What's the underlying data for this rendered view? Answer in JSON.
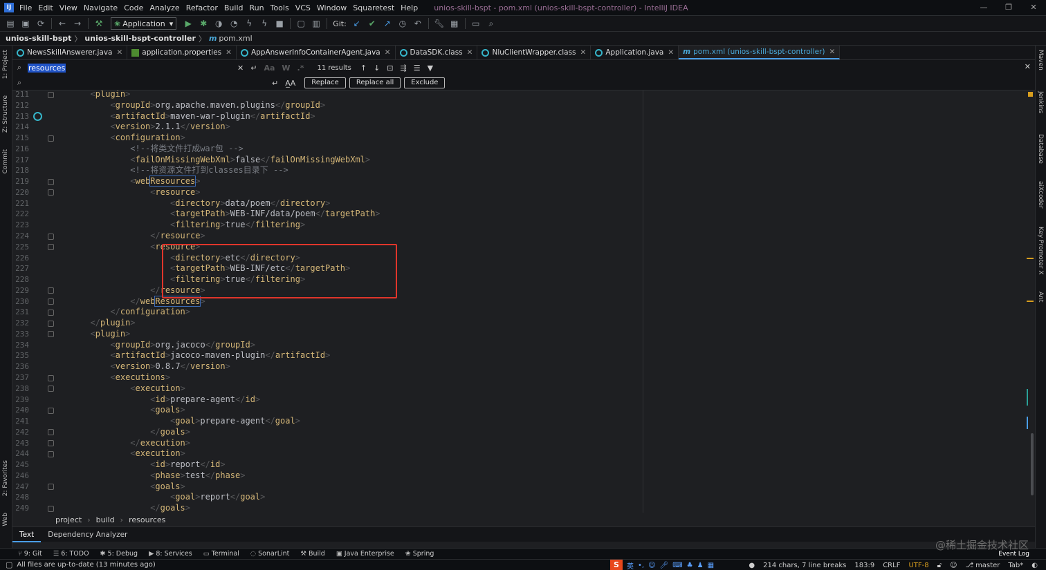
{
  "window": {
    "title": "unios-skill-bspt - pom.xml (unios-skill-bspt-controller) - IntelliJ IDEA",
    "menu": [
      "File",
      "Edit",
      "View",
      "Navigate",
      "Code",
      "Analyze",
      "Refactor",
      "Build",
      "Run",
      "Tools",
      "VCS",
      "Window",
      "Squaretest",
      "Help"
    ]
  },
  "toolbar": {
    "run_config": "Application",
    "git_label": "Git:"
  },
  "breadcrumb": {
    "project": "unios-skill-bspt",
    "module": "unios-skill-bspt-controller",
    "file_prefix": "m",
    "file": "pom.xml"
  },
  "tabs": [
    {
      "label": "NewsSkillAnswerer.java",
      "icon": "java-class-icon"
    },
    {
      "label": "application.properties",
      "icon": "properties-file-icon"
    },
    {
      "label": "AppAnswerInfoContainerAgent.java",
      "icon": "java-class-icon"
    },
    {
      "label": "DataSDK.class",
      "icon": "class-file-icon"
    },
    {
      "label": "NluClientWrapper.class",
      "icon": "class-file-icon"
    },
    {
      "label": "Application.java",
      "icon": "java-class-icon"
    },
    {
      "label": "pom.xml (unios-skill-bspt-controller)",
      "icon": "maven-icon",
      "prefix": "m"
    }
  ],
  "find": {
    "query": "resources",
    "case_btn": "Aa",
    "words_btn": "W",
    "regex_btn": ".*",
    "results": "11 results",
    "replace_label": "Replace",
    "replace_all_label": "Replace all",
    "exclude_label": "Exclude",
    "replace_aa": "A̲A"
  },
  "code": {
    "lines": [
      {
        "n": "211",
        "i": 2,
        "p": [
          [
            "b",
            "<"
          ],
          [
            "t",
            "plugin"
          ],
          [
            "b",
            ">"
          ]
        ]
      },
      {
        "n": "212",
        "i": 3,
        "p": [
          [
            "b",
            "<"
          ],
          [
            "t",
            "groupId"
          ],
          [
            "b",
            ">"
          ],
          [
            "tx",
            "org.apache.maven.plugins"
          ],
          [
            "b",
            "</"
          ],
          [
            "t",
            "groupId"
          ],
          [
            "b",
            ">"
          ]
        ]
      },
      {
        "n": "213",
        "i": 3,
        "p": [
          [
            "b",
            "<"
          ],
          [
            "t",
            "artifactId"
          ],
          [
            "b",
            ">"
          ],
          [
            "tx",
            "maven-war-plugin"
          ],
          [
            "b",
            "</"
          ],
          [
            "t",
            "artifactId"
          ],
          [
            "b",
            ">"
          ]
        ]
      },
      {
        "n": "214",
        "i": 3,
        "p": [
          [
            "b",
            "<"
          ],
          [
            "t",
            "version"
          ],
          [
            "b",
            ">"
          ],
          [
            "tx",
            "2.1.1"
          ],
          [
            "b",
            "</"
          ],
          [
            "t",
            "version"
          ],
          [
            "b",
            ">"
          ]
        ]
      },
      {
        "n": "215",
        "i": 3,
        "p": [
          [
            "b",
            "<"
          ],
          [
            "t",
            "configuration"
          ],
          [
            "b",
            ">"
          ]
        ]
      },
      {
        "n": "216",
        "i": 4,
        "p": [
          [
            "c",
            "<!--将类文件打成war包 -->"
          ]
        ]
      },
      {
        "n": "217",
        "i": 4,
        "p": [
          [
            "b",
            "<"
          ],
          [
            "t",
            "failOnMissingWebXml"
          ],
          [
            "b",
            ">"
          ],
          [
            "tx",
            "false"
          ],
          [
            "b",
            "</"
          ],
          [
            "t",
            "failOnMissingWebXml"
          ],
          [
            "b",
            ">"
          ]
        ]
      },
      {
        "n": "218",
        "i": 4,
        "p": [
          [
            "c",
            "<!--将资源文件打到classes目录下 -->"
          ]
        ]
      },
      {
        "n": "219",
        "i": 4,
        "p": [
          [
            "b",
            "<"
          ],
          [
            "t",
            "web"
          ],
          [
            "hl",
            "Resources"
          ],
          [
            "b",
            ">"
          ]
        ]
      },
      {
        "n": "220",
        "i": 5,
        "p": [
          [
            "b",
            "<"
          ],
          [
            "t",
            "resource"
          ],
          [
            "b",
            ">"
          ]
        ]
      },
      {
        "n": "221",
        "i": 6,
        "p": [
          [
            "b",
            "<"
          ],
          [
            "t",
            "directory"
          ],
          [
            "b",
            ">"
          ],
          [
            "tx",
            "data/poem"
          ],
          [
            "b",
            "</"
          ],
          [
            "t",
            "directory"
          ],
          [
            "b",
            ">"
          ]
        ]
      },
      {
        "n": "222",
        "i": 6,
        "p": [
          [
            "b",
            "<"
          ],
          [
            "t",
            "targetPath"
          ],
          [
            "b",
            ">"
          ],
          [
            "tx",
            "WEB-INF/data/poem"
          ],
          [
            "b",
            "</"
          ],
          [
            "t",
            "targetPath"
          ],
          [
            "b",
            ">"
          ]
        ]
      },
      {
        "n": "223",
        "i": 6,
        "p": [
          [
            "b",
            "<"
          ],
          [
            "t",
            "filtering"
          ],
          [
            "b",
            ">"
          ],
          [
            "tx",
            "true"
          ],
          [
            "b",
            "</"
          ],
          [
            "t",
            "filtering"
          ],
          [
            "b",
            ">"
          ]
        ]
      },
      {
        "n": "224",
        "i": 5,
        "p": [
          [
            "b",
            "</"
          ],
          [
            "t",
            "resource"
          ],
          [
            "b",
            ">"
          ]
        ]
      },
      {
        "n": "225",
        "i": 5,
        "p": [
          [
            "b",
            "<"
          ],
          [
            "t",
            "resource"
          ],
          [
            "b",
            ">"
          ]
        ]
      },
      {
        "n": "226",
        "i": 6,
        "p": [
          [
            "b",
            "<"
          ],
          [
            "t",
            "directory"
          ],
          [
            "b",
            ">"
          ],
          [
            "tx",
            "etc"
          ],
          [
            "b",
            "</"
          ],
          [
            "t",
            "directory"
          ],
          [
            "b",
            ">"
          ]
        ]
      },
      {
        "n": "227",
        "i": 6,
        "p": [
          [
            "b",
            "<"
          ],
          [
            "t",
            "targetPath"
          ],
          [
            "b",
            ">"
          ],
          [
            "tx",
            "WEB-INF/etc"
          ],
          [
            "b",
            "</"
          ],
          [
            "t",
            "targetPath"
          ],
          [
            "b",
            ">"
          ]
        ]
      },
      {
        "n": "228",
        "i": 6,
        "p": [
          [
            "b",
            "<"
          ],
          [
            "t",
            "filtering"
          ],
          [
            "b",
            ">"
          ],
          [
            "tx",
            "true"
          ],
          [
            "b",
            "</"
          ],
          [
            "t",
            "filtering"
          ],
          [
            "b",
            ">"
          ]
        ]
      },
      {
        "n": "229",
        "i": 5,
        "p": [
          [
            "b",
            "</"
          ],
          [
            "t",
            "resource"
          ],
          [
            "b",
            ">"
          ]
        ]
      },
      {
        "n": "230",
        "i": 4,
        "p": [
          [
            "b",
            "</"
          ],
          [
            "t",
            "web"
          ],
          [
            "hl",
            "Resources"
          ],
          [
            "b",
            ">"
          ]
        ]
      },
      {
        "n": "231",
        "i": 3,
        "p": [
          [
            "b",
            "</"
          ],
          [
            "t",
            "configuration"
          ],
          [
            "b",
            ">"
          ]
        ]
      },
      {
        "n": "232",
        "i": 2,
        "p": [
          [
            "b",
            "</"
          ],
          [
            "t",
            "plugin"
          ],
          [
            "b",
            ">"
          ]
        ]
      },
      {
        "n": "233",
        "i": 2,
        "p": [
          [
            "b",
            "<"
          ],
          [
            "t",
            "plugin"
          ],
          [
            "b",
            ">"
          ]
        ]
      },
      {
        "n": "234",
        "i": 3,
        "p": [
          [
            "b",
            "<"
          ],
          [
            "t",
            "groupId"
          ],
          [
            "b",
            ">"
          ],
          [
            "tx",
            "org.jacoco"
          ],
          [
            "b",
            "</"
          ],
          [
            "t",
            "groupId"
          ],
          [
            "b",
            ">"
          ]
        ]
      },
      {
        "n": "235",
        "i": 3,
        "p": [
          [
            "b",
            "<"
          ],
          [
            "t",
            "artifactId"
          ],
          [
            "b",
            ">"
          ],
          [
            "tx",
            "jacoco-maven-plugin"
          ],
          [
            "b",
            "</"
          ],
          [
            "t",
            "artifactId"
          ],
          [
            "b",
            ">"
          ]
        ]
      },
      {
        "n": "236",
        "i": 3,
        "p": [
          [
            "b",
            "<"
          ],
          [
            "t",
            "version"
          ],
          [
            "b",
            ">"
          ],
          [
            "tx",
            "0.8.7"
          ],
          [
            "b",
            "</"
          ],
          [
            "t",
            "version"
          ],
          [
            "b",
            ">"
          ]
        ]
      },
      {
        "n": "237",
        "i": 3,
        "p": [
          [
            "b",
            "<"
          ],
          [
            "t",
            "executions"
          ],
          [
            "b",
            ">"
          ]
        ]
      },
      {
        "n": "238",
        "i": 4,
        "p": [
          [
            "b",
            "<"
          ],
          [
            "t",
            "execution"
          ],
          [
            "b",
            ">"
          ]
        ]
      },
      {
        "n": "239",
        "i": 5,
        "p": [
          [
            "b",
            "<"
          ],
          [
            "t",
            "id"
          ],
          [
            "b",
            ">"
          ],
          [
            "tx",
            "prepare-agent"
          ],
          [
            "b",
            "</"
          ],
          [
            "t",
            "id"
          ],
          [
            "b",
            ">"
          ]
        ]
      },
      {
        "n": "240",
        "i": 5,
        "p": [
          [
            "b",
            "<"
          ],
          [
            "t",
            "goals"
          ],
          [
            "b",
            ">"
          ]
        ]
      },
      {
        "n": "241",
        "i": 6,
        "p": [
          [
            "b",
            "<"
          ],
          [
            "t",
            "goal"
          ],
          [
            "b",
            ">"
          ],
          [
            "tx",
            "prepare-agent"
          ],
          [
            "b",
            "</"
          ],
          [
            "t",
            "goal"
          ],
          [
            "b",
            ">"
          ]
        ]
      },
      {
        "n": "242",
        "i": 5,
        "p": [
          [
            "b",
            "</"
          ],
          [
            "t",
            "goals"
          ],
          [
            "b",
            ">"
          ]
        ]
      },
      {
        "n": "243",
        "i": 4,
        "p": [
          [
            "b",
            "</"
          ],
          [
            "t",
            "execution"
          ],
          [
            "b",
            ">"
          ]
        ]
      },
      {
        "n": "244",
        "i": 4,
        "p": [
          [
            "b",
            "<"
          ],
          [
            "t",
            "execution"
          ],
          [
            "b",
            ">"
          ]
        ]
      },
      {
        "n": "245",
        "i": 5,
        "p": [
          [
            "b",
            "<"
          ],
          [
            "t",
            "id"
          ],
          [
            "b",
            ">"
          ],
          [
            "tx",
            "report"
          ],
          [
            "b",
            "</"
          ],
          [
            "t",
            "id"
          ],
          [
            "b",
            ">"
          ]
        ]
      },
      {
        "n": "246",
        "i": 5,
        "p": [
          [
            "b",
            "<"
          ],
          [
            "t",
            "phase"
          ],
          [
            "b",
            ">"
          ],
          [
            "tx",
            "test"
          ],
          [
            "b",
            "</"
          ],
          [
            "t",
            "phase"
          ],
          [
            "b",
            ">"
          ]
        ]
      },
      {
        "n": "247",
        "i": 5,
        "p": [
          [
            "b",
            "<"
          ],
          [
            "t",
            "goals"
          ],
          [
            "b",
            ">"
          ]
        ]
      },
      {
        "n": "248",
        "i": 6,
        "p": [
          [
            "b",
            "<"
          ],
          [
            "t",
            "goal"
          ],
          [
            "b",
            ">"
          ],
          [
            "tx",
            "report"
          ],
          [
            "b",
            "</"
          ],
          [
            "t",
            "goal"
          ],
          [
            "b",
            ">"
          ]
        ]
      },
      {
        "n": "249",
        "i": 5,
        "p": [
          [
            "b",
            "</"
          ],
          [
            "t",
            "goals"
          ],
          [
            "b",
            ">"
          ]
        ]
      }
    ],
    "fold_lines": [
      "211",
      "215",
      "219",
      "220",
      "224",
      "225",
      "229",
      "230",
      "231",
      "232",
      "233",
      "237",
      "238",
      "240",
      "242",
      "243",
      "244",
      "247",
      "249"
    ]
  },
  "pathbar": [
    "project",
    "build",
    "resources"
  ],
  "editor_tabs": [
    "Text",
    "Dependency Analyzer"
  ],
  "left_tools": [
    "1: Project",
    "Z: Structure",
    "Commit",
    "2: Favorites",
    "Web"
  ],
  "right_tools": [
    "Maven",
    "Jenkins",
    "Database",
    "aiXcoder",
    "Key Promoter X",
    "Ant"
  ],
  "tool_windows": [
    {
      "label": "9: Git",
      "icon": "git-icon"
    },
    {
      "label": "6: TODO",
      "icon": "todo-icon"
    },
    {
      "label": "5: Debug",
      "icon": "debug-icon"
    },
    {
      "label": "8: Services",
      "icon": "services-icon"
    },
    {
      "label": "Terminal",
      "icon": "terminal-icon"
    },
    {
      "label": "SonarLint",
      "icon": "sonarlint-icon"
    },
    {
      "label": "Build",
      "icon": "build-icon"
    },
    {
      "label": "Java Enterprise",
      "icon": "java-enterprise-icon"
    },
    {
      "label": "Spring",
      "icon": "spring-icon"
    }
  ],
  "status": {
    "message": "All files are up-to-date (13 minutes ago)",
    "chars": "214 chars, 7 line breaks",
    "position": "183:9",
    "line_sep": "CRLF",
    "encoding": "UTF-8",
    "branch": "master",
    "indent": "Tab*",
    "event_log": "Event Log",
    "ime_lang": "英"
  },
  "watermark": "@稀土掘金技术社区",
  "colors": {
    "accent": "#4a9ee8",
    "tag": "#d5b778",
    "bracket": "#595a5c",
    "comment": "#7a7e85",
    "highlight_box": "#e0352b"
  }
}
